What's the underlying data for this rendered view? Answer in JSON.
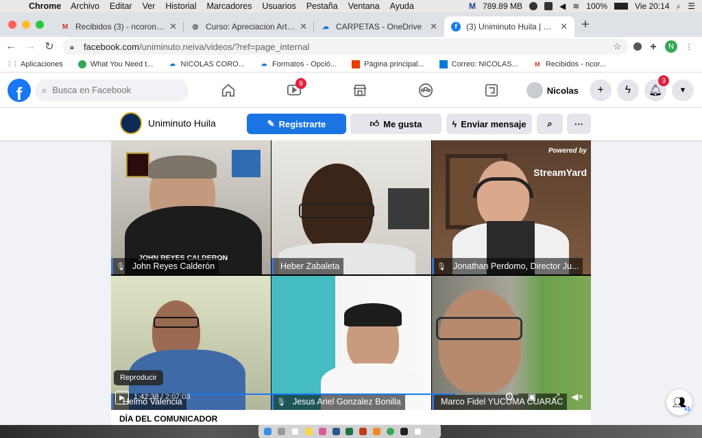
{
  "menubar": {
    "app": "Chrome",
    "menus": [
      "Archivo",
      "Editar",
      "Ver",
      "Historial",
      "Marcadores",
      "Usuarios",
      "Pestaña",
      "Ventana",
      "Ayuda"
    ],
    "memory": "789.89 MB",
    "battery": "100%",
    "clock": "Vie 20:14"
  },
  "tabs": [
    {
      "title": "Recibidos (3) - ncoronadolo@u",
      "icon": "gmail-icon",
      "color": "#d93025"
    },
    {
      "title": "Curso: Apreciacion Artistica",
      "icon": "globe-icon",
      "color": "#5f6368"
    },
    {
      "title": "CARPETAS - OneDrive",
      "icon": "onedrive-icon",
      "color": "#0a74da"
    },
    {
      "title": "(3) Uniminuto Huila | Facebook",
      "icon": "facebook-icon",
      "color": "#1877f2"
    }
  ],
  "address": {
    "domain": "facebook.com",
    "path": "/uniminuto.neiva/videos/?ref=page_internal"
  },
  "profile_initial": "N",
  "bookmarks": [
    {
      "label": "Aplicaciones",
      "icon": "apps-grid-icon",
      "color": "#4285f4"
    },
    {
      "label": "What You Need t...",
      "icon": "chrome-icon",
      "color": "#34a853"
    },
    {
      "label": "NICOLAS CORO...",
      "icon": "onedrive-icon",
      "color": "#0a74da"
    },
    {
      "label": "Formatos - Opció...",
      "icon": "onedrive-icon",
      "color": "#0a74da"
    },
    {
      "label": "Página principal...",
      "icon": "office-icon",
      "color": "#eb3c00"
    },
    {
      "label": "Correo: NICOLAS...",
      "icon": "outlook-icon",
      "color": "#0078d4"
    },
    {
      "label": "Recibidos - ncor...",
      "icon": "gmail-icon",
      "color": "#d93025"
    }
  ],
  "fb": {
    "search_placeholder": "Busca en Facebook",
    "watch_badge": "9",
    "profile_name": "Nicolas",
    "notif_badge": "3"
  },
  "page": {
    "name": "Uniminuto Huila",
    "btn_register": "Registrarte",
    "btn_like": "Me gusta",
    "btn_message": "Enviar mensaje"
  },
  "video": {
    "participants": [
      {
        "name": "John Reyes Calderón",
        "muted": true
      },
      {
        "name": "Heber Zabaleta",
        "muted": false
      },
      {
        "name": "Jonathan Perdomo, Director Ju...",
        "muted": true
      },
      {
        "name": "Helmo Valencia",
        "muted": false
      },
      {
        "name": "Jesus Ariel Gonzalez Bonilla",
        "muted": true
      },
      {
        "name": "Marco Fidel YUCUMA CUARAC",
        "muted": false
      }
    ],
    "overlay_banner": "JOHN REYES CALDERON",
    "watermark_powered": "Powered by",
    "watermark_brand": "StreamYard",
    "tooltip": "Reproducir",
    "current_time": "1:42:38",
    "duration": "2:07:03",
    "progress": 0.808,
    "title": "DÍA DEL COMUNICADOR"
  },
  "friends_count": "51"
}
